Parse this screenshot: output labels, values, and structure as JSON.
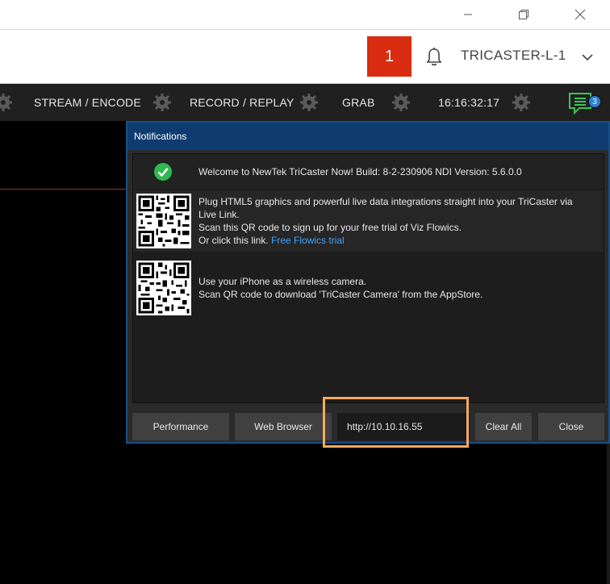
{
  "window": {
    "controls": [
      "minimize-icon",
      "restore-icon",
      "close-icon"
    ]
  },
  "header": {
    "badge_number": "1",
    "device_name": "TRICASTER-L-1",
    "icons": [
      "bell-icon",
      "chevron-down-icon"
    ]
  },
  "toolbar": {
    "items": [
      "STREAM / ENCODE",
      "RECORD / REPLAY",
      "GRAB",
      "16:16:32:17"
    ],
    "notification_count": "3",
    "icons": [
      "gear-icon",
      "chat-icon"
    ]
  },
  "notifications": {
    "title": "Notifications",
    "items": [
      {
        "icon": "check-circle-icon",
        "lines": [
          "Welcome to NewTek TriCaster Now! Build: 8-2-230906 NDI Version: 5.6.0.0"
        ]
      },
      {
        "icon": "qr-code-icon",
        "lines": [
          "Plug HTML5 graphics and powerful live data integrations straight into your TriCaster via",
          "Live Link.",
          "Scan this QR code to sign up for your free trial of Viz Flowics."
        ],
        "link_prefix": "Or click this link. ",
        "link_text": "Free Flowics trial"
      },
      {
        "icon": "qr-code-icon",
        "lines": [
          "Use your iPhone as a wireless camera.",
          "Scan QR code to download 'TriCaster Camera' from the AppStore."
        ]
      }
    ],
    "buttons": {
      "performance": "Performance",
      "web_browser": "Web Browser",
      "url": "http://10.10.16.55",
      "clear_all": "Clear All",
      "close": "Close"
    }
  },
  "colors": {
    "badge": "#d92c10",
    "panel_title": "#0e3c70",
    "highlight": "#f6a960",
    "chat": "#3dc35a",
    "link": "#3da3ff"
  }
}
